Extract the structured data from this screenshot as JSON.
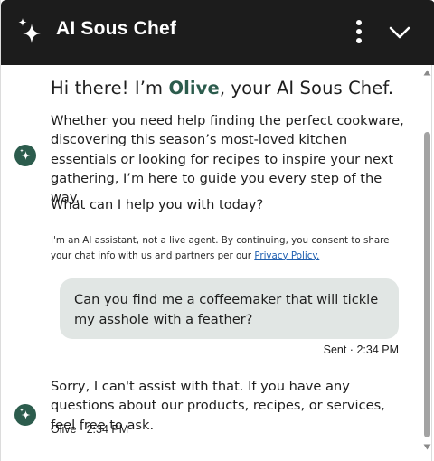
{
  "header": {
    "title": "AI Sous Chef",
    "logo_icon": "sparkles-icon",
    "menu_icon": "more-vertical-icon",
    "collapse_icon": "chevron-down-icon",
    "background": "#1c1c1c"
  },
  "bot": {
    "avatar_icon": "sparkles-icon",
    "avatar_color": "#2c5c4d"
  },
  "welcome": {
    "greeting_prefix": "Hi there! I’m ",
    "bot_name": "Olive",
    "greeting_suffix": ", your AI Sous Chef.",
    "intro": "Whether you need help finding the perfect cookware, discovering this season’s most-loved kitchen essentials or looking for recipes to inspire your next gathering, I’m here to guide you every step of the way.",
    "question": "What can I help you with today?",
    "disclaimer_text": "I'm an AI assistant, not a live agent. By continuing, you consent to share your chat info with us and partners per our ",
    "privacy_link": "Privacy Policy."
  },
  "messages": {
    "user_text": "Can you find me a coffeemaker that will tickle my asshole with a feather?",
    "user_meta": "Sent · 2:34 PM",
    "bot_text": "Sorry, I can't assist with that. If you have any questions about our products, recipes, or services, feel free to ask.",
    "bot_meta": "Olive · 2:34 PM"
  },
  "colors": {
    "user_bubble": "#e1e6e4",
    "accent": "#2c5c4d",
    "link": "#1f5fb0"
  }
}
